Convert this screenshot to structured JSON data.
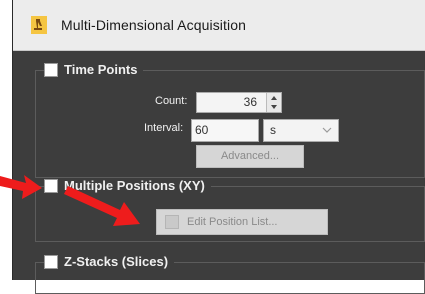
{
  "window": {
    "title": "Multi-Dimensional Acquisition",
    "icon": "microscope-icon"
  },
  "time_points": {
    "label": "Time Points",
    "checked": false,
    "count_label": "Count:",
    "count_value": "36",
    "interval_label": "Interval:",
    "interval_value": "60",
    "interval_unit": "s",
    "advanced_label": "Advanced..."
  },
  "multiple_positions": {
    "label": "Multiple Positions (XY)",
    "checked": false,
    "edit_label": "Edit Position List..."
  },
  "z_stacks": {
    "label": "Z-Stacks (Slices)",
    "checked": false
  },
  "colors": {
    "annotation_arrow": "#ee1c1c",
    "panel_bg": "#3d3d3d"
  }
}
